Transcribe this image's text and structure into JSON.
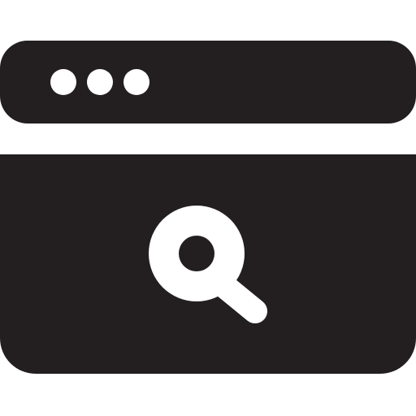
{
  "icon": {
    "name": "browser-search-icon",
    "fill_color": "#231f20",
    "accent_color": "#ffffff"
  },
  "title_bar": {
    "window_controls": [
      "dot",
      "dot",
      "dot"
    ]
  },
  "content": {
    "icon_name": "magnifier-icon"
  }
}
